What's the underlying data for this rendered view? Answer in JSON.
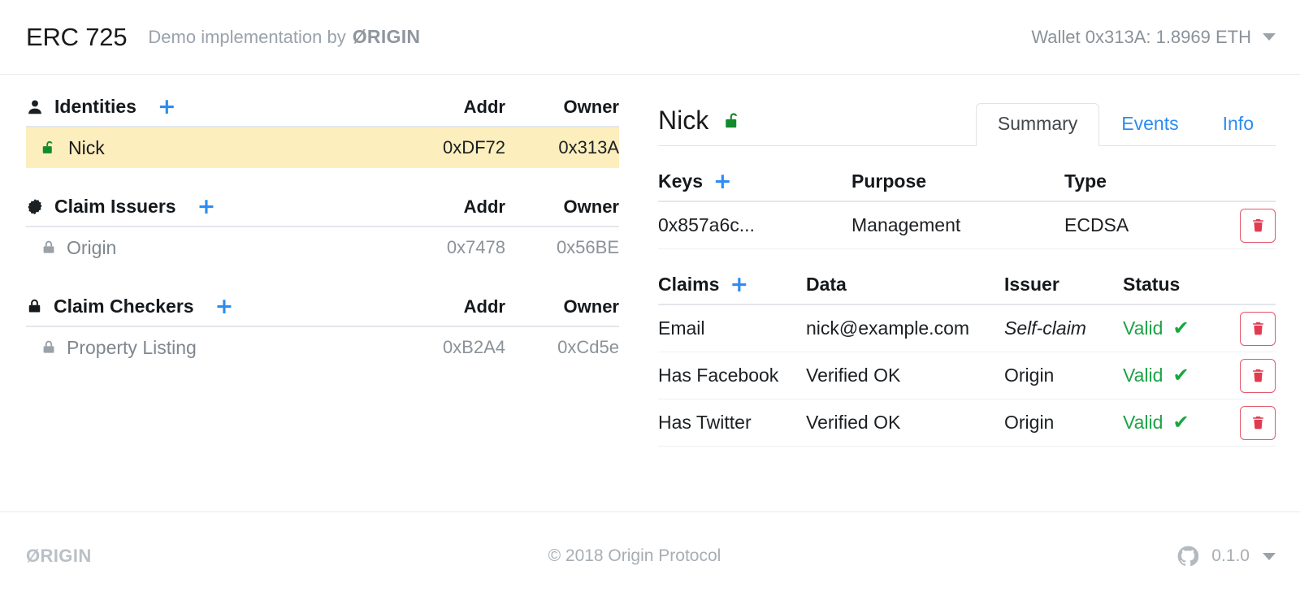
{
  "header": {
    "title": "ERC 725",
    "subtitle_prefix": "Demo implementation by",
    "subtitle_brand": "ØRIGIN",
    "wallet_label": "Wallet 0x313A: 1.8969 ETH",
    "wallet_caret_icon": "chevron-down-icon"
  },
  "sidebar": {
    "sections": [
      {
        "title": "Identities",
        "icon": "person-icon",
        "add_label": "+",
        "col_addr": "Addr",
        "col_owner": "Owner",
        "rows": [
          {
            "icon": "unlock-icon-green",
            "label": "Nick",
            "addr": "0xDF72",
            "owner": "0x313A",
            "selected": true
          }
        ]
      },
      {
        "title": "Claim Issuers",
        "icon": "certificate-badge-icon",
        "add_label": "+",
        "col_addr": "Addr",
        "col_owner": "Owner",
        "rows": [
          {
            "icon": "lock-icon-gray",
            "label": "Origin",
            "addr": "0x7478",
            "owner": "0x56BE",
            "selected": false
          }
        ]
      },
      {
        "title": "Claim Checkers",
        "icon": "lock-icon-black",
        "add_label": "+",
        "col_addr": "Addr",
        "col_owner": "Owner",
        "rows": [
          {
            "icon": "lock-icon-gray",
            "label": "Property Listing",
            "addr": "0xB2A4",
            "owner": "0xCd5e",
            "selected": false
          }
        ]
      }
    ]
  },
  "detail": {
    "name": "Nick",
    "name_icon": "unlock-icon-green",
    "tabs": [
      {
        "label": "Summary",
        "active": true
      },
      {
        "label": "Events",
        "active": false
      },
      {
        "label": "Info",
        "active": false
      }
    ],
    "keys": {
      "title": "Keys",
      "add_label": "+",
      "columns": [
        "Purpose",
        "Type"
      ],
      "rows": [
        {
          "key": "0x857a6c...",
          "purpose": "Management",
          "type": "ECDSA",
          "delete_icon": "trash-icon"
        }
      ]
    },
    "claims": {
      "title": "Claims",
      "add_label": "+",
      "columns": [
        "Data",
        "Issuer",
        "Status"
      ],
      "rows": [
        {
          "claim": "Email",
          "data": "nick@example.com",
          "issuer": "Self-claim",
          "issuer_italic": true,
          "status": "Valid",
          "status_icon": "check-icon",
          "delete_icon": "trash-icon"
        },
        {
          "claim": "Has Facebook",
          "data": "Verified OK",
          "issuer": "Origin",
          "issuer_italic": false,
          "status": "Valid",
          "status_icon": "check-icon",
          "delete_icon": "trash-icon"
        },
        {
          "claim": "Has Twitter",
          "data": "Verified OK",
          "issuer": "Origin",
          "issuer_italic": false,
          "status": "Valid",
          "status_icon": "check-icon",
          "delete_icon": "trash-icon"
        }
      ]
    }
  },
  "footer": {
    "logo": "ØRIGIN",
    "copyright": "© 2018  Origin Protocol",
    "github_icon": "github-icon",
    "version": "0.1.0",
    "version_caret_icon": "chevron-down-icon"
  },
  "colors": {
    "accent_blue": "#2d8cf0",
    "selected_row": "#fdeebe",
    "valid_green": "#1ea347",
    "danger_red": "#e2566a",
    "muted_text": "#8b9298"
  }
}
